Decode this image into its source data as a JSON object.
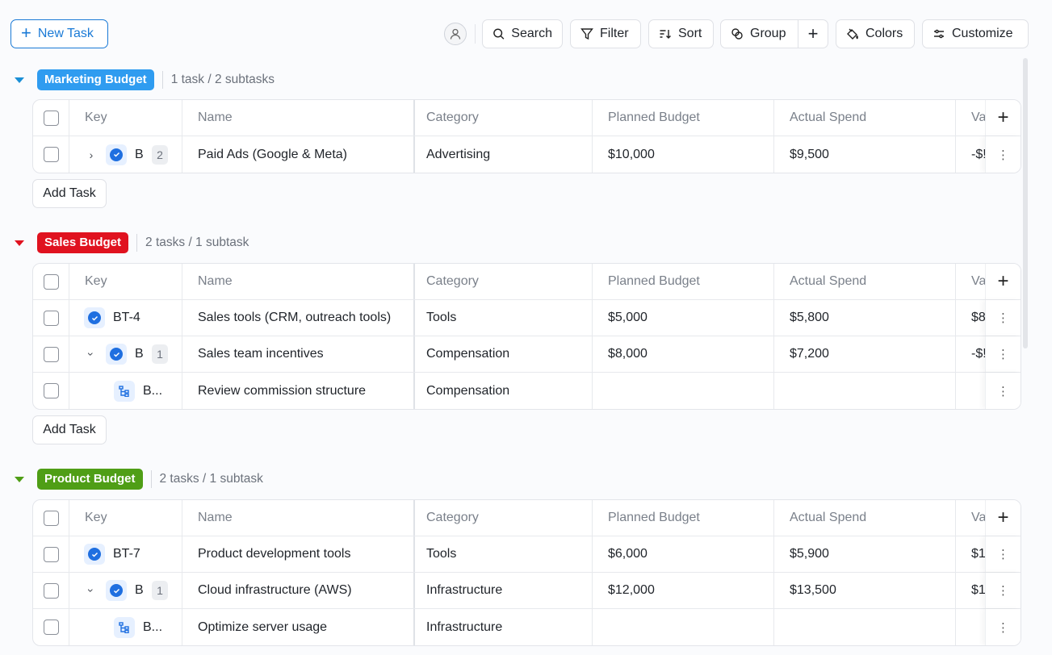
{
  "toolbar": {
    "new_task": "New Task",
    "search": "Search",
    "filter": "Filter",
    "sort": "Sort",
    "group": "Group",
    "colors": "Colors",
    "customize": "Customize"
  },
  "columns": {
    "key": "Key",
    "name": "Name",
    "category": "Category",
    "planned": "Planned Budget",
    "actual": "Actual Spend",
    "variance": "Va"
  },
  "add_task_label": "Add Task",
  "groups": [
    {
      "label": "Marketing Budget",
      "color": "#2f9cf0",
      "count": "1 task / 2 subtasks",
      "rows": [
        {
          "key": "B",
          "subcount": "2",
          "name": "Paid Ads (Google & Meta)",
          "category": "Advertising",
          "planned": "$10,000",
          "actual": "$9,500",
          "variance": "-$!"
        }
      ]
    },
    {
      "label": "Sales Budget",
      "color": "#e0121f",
      "count": "2 tasks / 1 subtask",
      "rows": [
        {
          "key": "BT-4",
          "name": "Sales tools (CRM, outreach tools)",
          "category": "Tools",
          "planned": "$5,000",
          "actual": "$5,800",
          "variance": "$8"
        },
        {
          "key": "B",
          "subcount": "1",
          "name": "Sales team incentives",
          "category": "Compensation",
          "planned": "$8,000",
          "actual": "$7,200",
          "variance": "-$!"
        },
        {
          "key": "B...",
          "name": "Review commission structure",
          "category": "Compensation",
          "planned": "",
          "actual": "",
          "variance": ""
        }
      ]
    },
    {
      "label": "Product Budget",
      "color": "#4f9e16",
      "count": "2 tasks / 1 subtask",
      "rows": [
        {
          "key": "BT-7",
          "name": "Product development tools",
          "category": "Tools",
          "planned": "$6,000",
          "actual": "$5,900",
          "variance": "$1"
        },
        {
          "key": "B",
          "subcount": "1",
          "name": "Cloud infrastructure (AWS)",
          "category": "Infrastructure",
          "planned": "$12,000",
          "actual": "$13,500",
          "variance": "$1"
        },
        {
          "key": "B...",
          "name": "Optimize server usage",
          "category": "Infrastructure",
          "planned": "",
          "actual": "",
          "variance": ""
        }
      ]
    }
  ]
}
